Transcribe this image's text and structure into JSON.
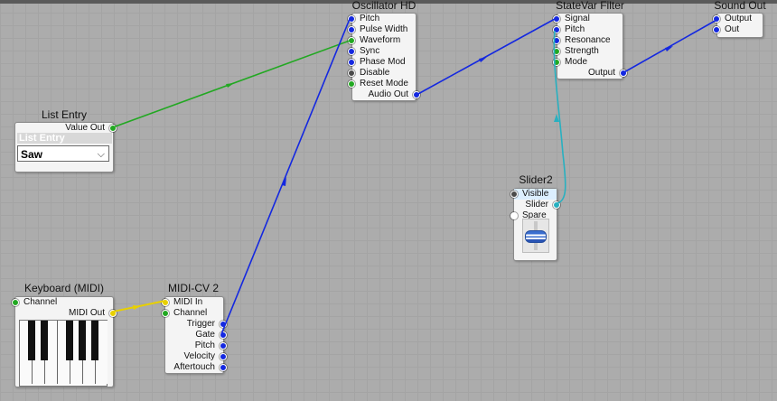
{
  "colors": {
    "blue": "#1428e0",
    "green": "#22a822",
    "yellow": "#e8d000",
    "cyan": "#28b0c0",
    "background": "#acacac"
  },
  "modules": {
    "oscillator": {
      "title": "Oscillator HD",
      "inputs": [
        "Pitch",
        "Pulse Width",
        "Waveform",
        "Sync",
        "Phase Mod",
        "Disable",
        "Reset Mode"
      ],
      "output": "Audio Out"
    },
    "filter": {
      "title": "StateVar Filter",
      "inputs": [
        "Signal",
        "Pitch",
        "Resonance",
        "Strength",
        "Mode"
      ],
      "output": "Output"
    },
    "sound_out": {
      "title": "Sound Out",
      "inputs": [
        "Output",
        "Out"
      ]
    },
    "list_entry": {
      "title": "List Entry",
      "output": "Value Out",
      "header": "List Entry",
      "selected": "Saw"
    },
    "slider": {
      "title": "Slider2",
      "inputs": [
        "Visible",
        "Spare"
      ],
      "output": "Slider"
    },
    "keyboard": {
      "title": "Keyboard (MIDI)",
      "input": "Channel",
      "output": "MIDI Out"
    },
    "midi_cv": {
      "title": "MIDI-CV 2",
      "inputs": [
        "MIDI In",
        "Channel"
      ],
      "outputs": [
        "Trigger",
        "Gate",
        "Pitch",
        "Velocity",
        "Aftertouch"
      ]
    }
  }
}
